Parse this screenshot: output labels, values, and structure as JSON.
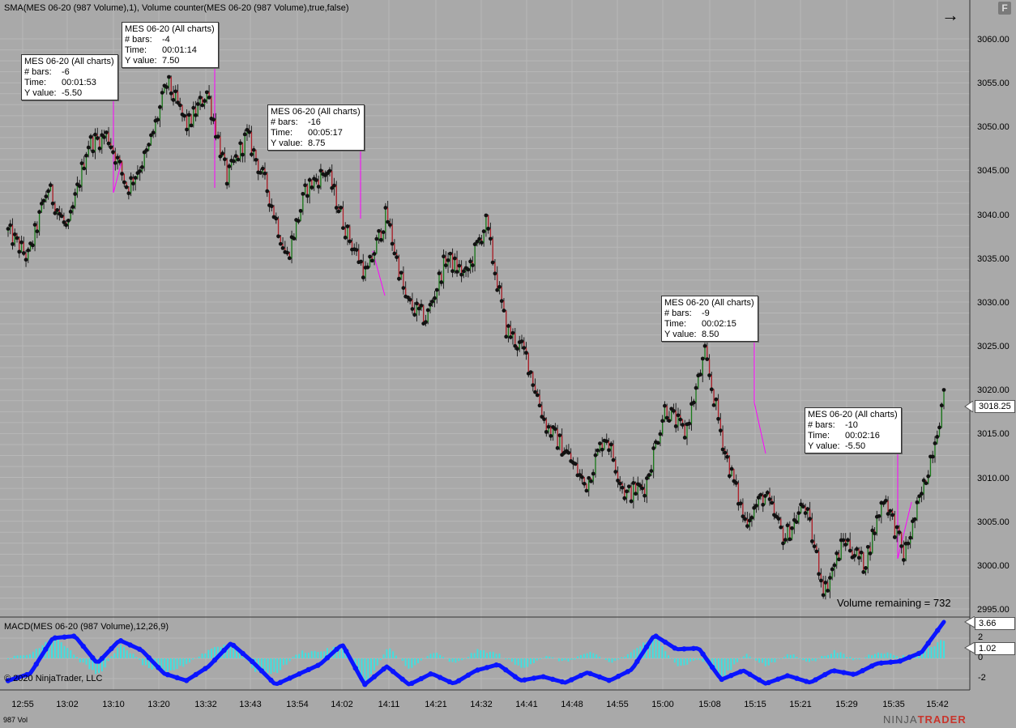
{
  "main_panel": {
    "indicator_title": "SMA(MES 06-20 (987 Volume),1), Volume counter(MES 06-20 (987 Volume),true,false)",
    "volume_remaining": "Volume remaining = 732",
    "current_price_tag": "3018.25",
    "price_axis_labels": [
      "3060.00",
      "3055.00",
      "3050.00",
      "3045.00",
      "3040.00",
      "3035.00",
      "3030.00",
      "3025.00",
      "3020.00",
      "3015.00",
      "3010.00",
      "3005.00",
      "3000.00",
      "2995.00"
    ]
  },
  "macd_panel": {
    "title": "MACD(MES 06-20 (987 Volume),12,26,9)",
    "copyright": "© 2020 NinjaTrader, LLC",
    "value_tag_1": "3.66",
    "value_tag_2": "1.02",
    "axis_labels": [
      "2",
      "0",
      "-2"
    ]
  },
  "time_axis_labels": [
    "12:55",
    "13:02",
    "13:10",
    "13:20",
    "13:32",
    "13:43",
    "13:54",
    "14:02",
    "14:11",
    "14:21",
    "14:32",
    "14:41",
    "14:48",
    "14:55",
    "15:00",
    "15:08",
    "15:15",
    "15:21",
    "15:29",
    "15:35",
    "15:42"
  ],
  "footer": {
    "series_label": "987 Vol",
    "brand_ninja": "NINJA",
    "brand_trader": "TRADER"
  },
  "tooltips": [
    {
      "title": "MES 06-20 (All charts)",
      "bars_key": "# bars:",
      "bars": "-6",
      "time_key": "Time:",
      "time": "00:01:53",
      "y_key": "Y value:",
      "y": "-5.50"
    },
    {
      "title": "MES 06-20 (All charts)",
      "bars_key": "# bars:",
      "bars": "-4",
      "time_key": "Time:",
      "time": "00:01:14",
      "y_key": "Y value:",
      "y": "7.50"
    },
    {
      "title": "MES 06-20 (All charts)",
      "bars_key": "# bars:",
      "bars": "-16",
      "time_key": "Time:",
      "time": "00:05:17",
      "y_key": "Y value:",
      "y": "8.75"
    },
    {
      "title": "MES 06-20 (All charts)",
      "bars_key": "# bars:",
      "bars": "-9",
      "time_key": "Time:",
      "time": "00:02:15",
      "y_key": "Y value:",
      "y": "8.50"
    },
    {
      "title": "MES 06-20 (All charts)",
      "bars_key": "# bars:",
      "bars": "-10",
      "time_key": "Time:",
      "time": "00:02:16",
      "y_key": "Y value:",
      "y": "-5.50"
    }
  ],
  "colors": {
    "background": "#a9a9a9",
    "up_wick": "#1a7a1a",
    "down_wick": "#b0202a",
    "bar_dot": "#111111",
    "ruler_line": "#ff00ff",
    "macd_line": "#0a14ff",
    "macd_hist": "#40e0e0",
    "grid": "#b8b8b8"
  },
  "chart_data": {
    "type": "line",
    "title": "",
    "price_series": {
      "name": "",
      "anchor_prices": [
        3038,
        3035,
        3043,
        3038,
        3048,
        3049,
        3043,
        3047,
        3055,
        3050,
        3054,
        3044,
        3049,
        3043,
        3035,
        3043,
        3045,
        3038,
        3033,
        3040,
        3030,
        3028,
        3035,
        3033,
        3039,
        3027,
        3024,
        3016,
        3013,
        3009,
        3015,
        3008,
        3009,
        3018,
        3015,
        3024,
        3013,
        3005,
        3008,
        3003,
        3007,
        2997,
        3003,
        3000,
        3008,
        3001,
        3009,
        3019
      ],
      "ylim": [
        2994,
        3062
      ]
    },
    "macd_series": {
      "name": "",
      "anchor_values": [
        -2.2,
        -1.5,
        2.0,
        2.2,
        -0.5,
        1.8,
        0.8,
        -1.5,
        -2.2,
        -0.8,
        1.5,
        -0.4,
        -2.6,
        -1.6,
        -0.6,
        1.4,
        -2.6,
        -0.8,
        -2.6,
        -1.5,
        -2.5,
        -1.2,
        -0.6,
        -2.2,
        -1.8,
        -2.4,
        -1.4,
        -2.2,
        -1.1,
        2.3,
        0.9,
        1.0,
        -2.1,
        -1.2,
        -2.5,
        -1.7,
        -2.4,
        -1.2,
        -1.6,
        -0.5,
        -0.3,
        0.6,
        3.6
      ],
      "ylim": [
        -3.2,
        4.2
      ]
    }
  }
}
